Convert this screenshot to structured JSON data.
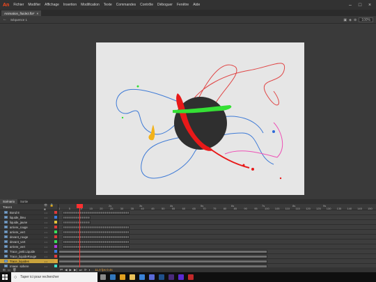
{
  "app": {
    "logo": "An"
  },
  "menu": [
    "Fichier",
    "Modifier",
    "Affichage",
    "Insertion",
    "Modification",
    "Texte",
    "Commandes",
    "Contrôle",
    "Déboguer",
    "Fenêtre",
    "Aide"
  ],
  "document_tab": {
    "name": "Animation_fluide2.fla*",
    "close": "×"
  },
  "scene": {
    "back": "←",
    "label": "Séquence 1",
    "zoom": "100%"
  },
  "timeline_tabs": [
    "Scénario",
    "Sortie"
  ],
  "timeline": {
    "root": "Trace1",
    "header_icons": "👁 🔒 ■",
    "layers": [
      {
        "name": "Bond 8",
        "color": "#e03a3a"
      },
      {
        "name": "liquide_bleu",
        "color": "#3a7be0"
      },
      {
        "name": "liquide_jaune",
        "color": "#e0c23a"
      },
      {
        "name": "arriere_rouge",
        "color": "#e03a3a"
      },
      {
        "name": "arriere_vert",
        "color": "#3ae05a"
      },
      {
        "name": "devant_rouge",
        "color": "#e03a3a"
      },
      {
        "name": "devant_vert",
        "color": "#3ae05a"
      },
      {
        "name": "arriere_vert",
        "color": "#b03ae0"
      },
      {
        "name": "Trace_petit.Liquide",
        "color": "#3a7be0"
      },
      {
        "name": "Trace_liquideRouge",
        "color": "#e03a3a"
      },
      {
        "name": "Trace_liquides",
        "color": "#e0a23a",
        "selected": true
      },
      {
        "name": "Image_sphere",
        "color": "#3ae0c8"
      }
    ],
    "ruler_seconds": [
      "1s",
      "2s",
      "3s",
      "4s",
      "5s",
      "6s",
      "7s",
      "8s",
      "9s"
    ],
    "ruler_frames": [
      "1",
      "5",
      "10",
      "15",
      "20",
      "25",
      "30",
      "35",
      "40",
      "45",
      "50",
      "55",
      "60",
      "65",
      "70",
      "75",
      "80",
      "85",
      "90",
      "95",
      "100",
      "105",
      "110",
      "115",
      "120",
      "125",
      "130",
      "135",
      "140",
      "145",
      "150"
    ],
    "readout": "11.0 fps  0.4s"
  },
  "taskbar": {
    "search_placeholder": "Taper ici pour rechercher",
    "apps": [
      {
        "name": "task-view",
        "color": "#8a8a8a"
      },
      {
        "name": "edge",
        "color": "#3277bc"
      },
      {
        "name": "chrome",
        "color": "#e0a020"
      },
      {
        "name": "explorer",
        "color": "#e8c15a"
      },
      {
        "name": "mail",
        "color": "#3a82d6"
      },
      {
        "name": "store",
        "color": "#5a6ad6"
      },
      {
        "name": "photoshop",
        "color": "#1f4f8a"
      },
      {
        "name": "premiere",
        "color": "#4a2a7a"
      },
      {
        "name": "after-effects",
        "color": "#5a2ad0"
      },
      {
        "name": "animate",
        "color": "#c0282a"
      }
    ]
  }
}
